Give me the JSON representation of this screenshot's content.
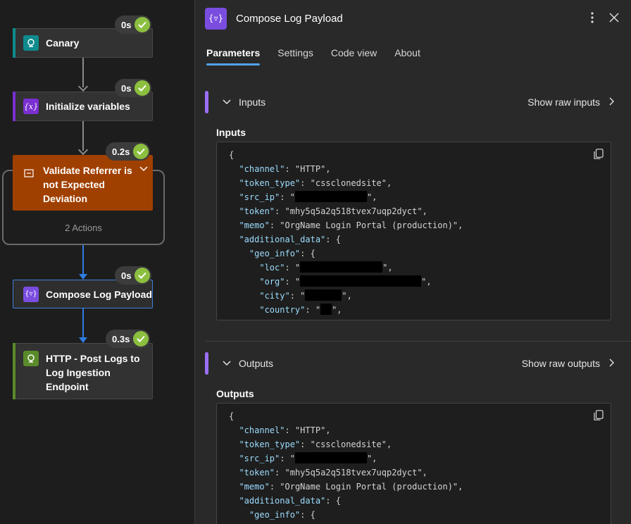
{
  "flow": {
    "nodes": [
      {
        "title": "Canary",
        "duration": "0s",
        "color": "#0f8b8d"
      },
      {
        "title": "Initialize variables",
        "duration": "0s",
        "color": "#7a2fd1"
      },
      {
        "title": "Validate Referrer is not Expected Deviation",
        "duration": "0.2s",
        "color": "#a04000"
      },
      {
        "title": "Compose Log Payload",
        "duration": "0s",
        "color": "#7a4de0"
      },
      {
        "title": "HTTP - Post Logs to Log Ingestion Endpoint",
        "duration": "0.3s",
        "color": "#5a8b2a"
      }
    ],
    "scope_label": "2 Actions"
  },
  "panel": {
    "title": "Compose Log Payload",
    "tabs": [
      "Parameters",
      "Settings",
      "Code view",
      "About"
    ],
    "inputs": {
      "section": "Inputs",
      "raw_label": "Show raw inputs",
      "label": "Inputs"
    },
    "outputs": {
      "section": "Outputs",
      "raw_label": "Show raw outputs",
      "label": "Outputs"
    },
    "json": {
      "channel": "HTTP",
      "token_type": "cssclonedsite",
      "token": "mhy5q5a2q518tvex7uqp2dyct",
      "memo": "OrgName Login Portal (production)"
    }
  }
}
